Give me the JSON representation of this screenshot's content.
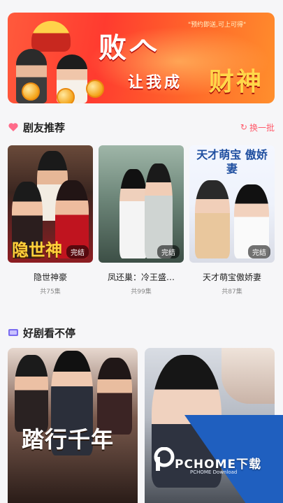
{
  "banner": {
    "title_line1": "败𠆢",
    "title_line2": "让我成",
    "title_highlight": "财神",
    "tagline": "\"预约即送,可上可得\""
  },
  "recommend": {
    "title": "剧友推荐",
    "refresh_label": "换一批",
    "items": [
      {
        "title": "隐世神豪",
        "episodes": "共75集",
        "status": "完结",
        "poster_caption": "隐世神"
      },
      {
        "title": "凤还巢：冷王盛…",
        "episodes": "共99集",
        "status": "完结",
        "poster_caption": ""
      },
      {
        "title": "天才萌宝傲娇妻",
        "episodes": "共87集",
        "status": "完结",
        "poster_caption": "天才萌宝 傲娇妻"
      }
    ]
  },
  "nonstop": {
    "title": "好剧看不停",
    "items": [
      {
        "poster_caption": "踏行千年"
      },
      {
        "poster_caption": ""
      }
    ]
  },
  "watermark": {
    "text": "PCHOME下载",
    "sub": "PCHOME Download"
  },
  "colors": {
    "accent": "#ff5a6a",
    "banner_red": "#ff3b2f",
    "watermark_blue": "#1f5fbf"
  }
}
